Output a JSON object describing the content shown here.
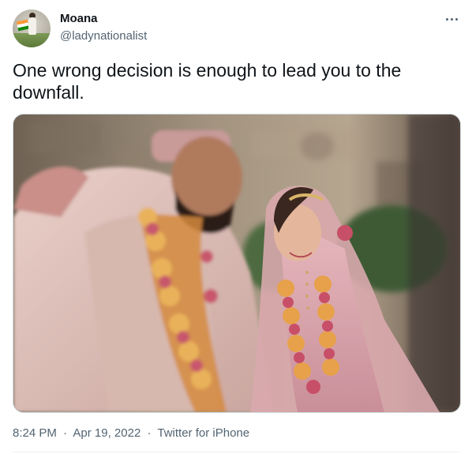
{
  "user": {
    "display_name": "Moana",
    "handle": "@ladynationalist",
    "avatar_icon": "profile-photo-avatar"
  },
  "tweet": {
    "text": "One wrong decision is enough to lead you to the downfall.",
    "more_icon": "more-options-icon"
  },
  "media": {
    "kind": "photo"
  },
  "meta": {
    "time": "8:24 PM",
    "separator": "·",
    "date": "Apr 19, 2022",
    "source": "Twitter for iPhone"
  },
  "colors": {
    "primary_text": "#0f1419",
    "secondary_text": "#536471",
    "border": "#cfd9de"
  }
}
